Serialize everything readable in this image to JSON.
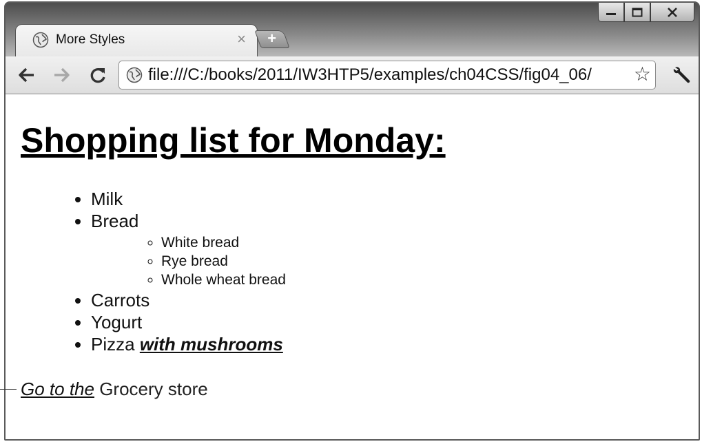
{
  "window": {
    "controls": {
      "minimize_icon": "minimize-icon",
      "maximize_icon": "maximize-icon",
      "close_icon": "close-icon"
    }
  },
  "tab": {
    "title": "More Styles",
    "close_glyph": "×",
    "new_tab_glyph": "+"
  },
  "toolbar": {
    "back_icon": "back-arrow-icon",
    "forward_icon": "forward-arrow-icon",
    "reload_icon": "reload-icon",
    "url": "file:///C:/books/2011/IW3HTP5/examples/ch04CSS/fig04_06/",
    "star_glyph": "☆",
    "wrench_icon": "wrench-icon"
  },
  "page": {
    "heading": "Shopping list for Monday:",
    "items": [
      {
        "label": "Milk"
      },
      {
        "label": "Bread",
        "subitems": [
          "White bread",
          "Rye bread",
          "Whole wheat bread"
        ]
      },
      {
        "label": "Carrots"
      },
      {
        "label": "Yogurt"
      },
      {
        "label": "Pizza",
        "emphasis": "with mushrooms"
      }
    ],
    "footer": {
      "link_text": "Go to the",
      "rest_text": "Grocery store"
    }
  }
}
